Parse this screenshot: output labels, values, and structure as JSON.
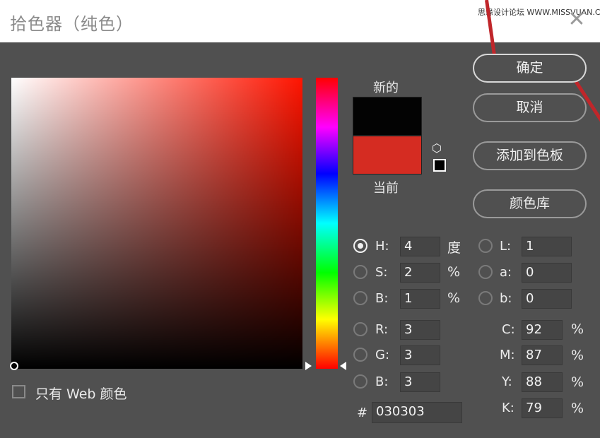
{
  "dialog": {
    "title": "拾色器（纯色）",
    "close_glyph": "✕",
    "watermark": "思缘设计论坛 WWW.MISSVUAN.COM"
  },
  "colors": {
    "new": "#030303",
    "current": "#d52c22",
    "pure_hue": "#ff1400",
    "annotation": "#c0262a"
  },
  "swatches": {
    "new_label": "新的",
    "current_label": "当前",
    "gamut_icon": "cube-icon",
    "websafe_icon": "websafe-swatch-icon"
  },
  "buttons": {
    "ok": "确定",
    "cancel": "取消",
    "add_to_swatches": "添加到色板",
    "color_libraries": "颜色库"
  },
  "fields": {
    "H": {
      "label": "H:",
      "value": "4",
      "unit": "度",
      "selected": true
    },
    "S": {
      "label": "S:",
      "value": "2",
      "unit": "%",
      "selected": false
    },
    "B": {
      "label": "B:",
      "value": "1",
      "unit": "%",
      "selected": false
    },
    "R": {
      "label": "R:",
      "value": "3",
      "selected": false
    },
    "G": {
      "label": "G:",
      "value": "3",
      "selected": false
    },
    "B2": {
      "label": "B:",
      "value": "3",
      "selected": false
    },
    "L": {
      "label": "L:",
      "value": "1",
      "selected": false
    },
    "a": {
      "label": "a:",
      "value": "0",
      "selected": false
    },
    "b": {
      "label": "b:",
      "value": "0",
      "selected": false
    },
    "C": {
      "label": "C:",
      "value": "92",
      "unit": "%"
    },
    "M": {
      "label": "M:",
      "value": "87",
      "unit": "%"
    },
    "Y": {
      "label": "Y:",
      "value": "88",
      "unit": "%"
    },
    "K": {
      "label": "K:",
      "value": "79",
      "unit": "%"
    },
    "hex": {
      "label": "#",
      "value": "030303"
    }
  },
  "web_only": {
    "label": "只有 Web 颜色",
    "checked": false
  }
}
